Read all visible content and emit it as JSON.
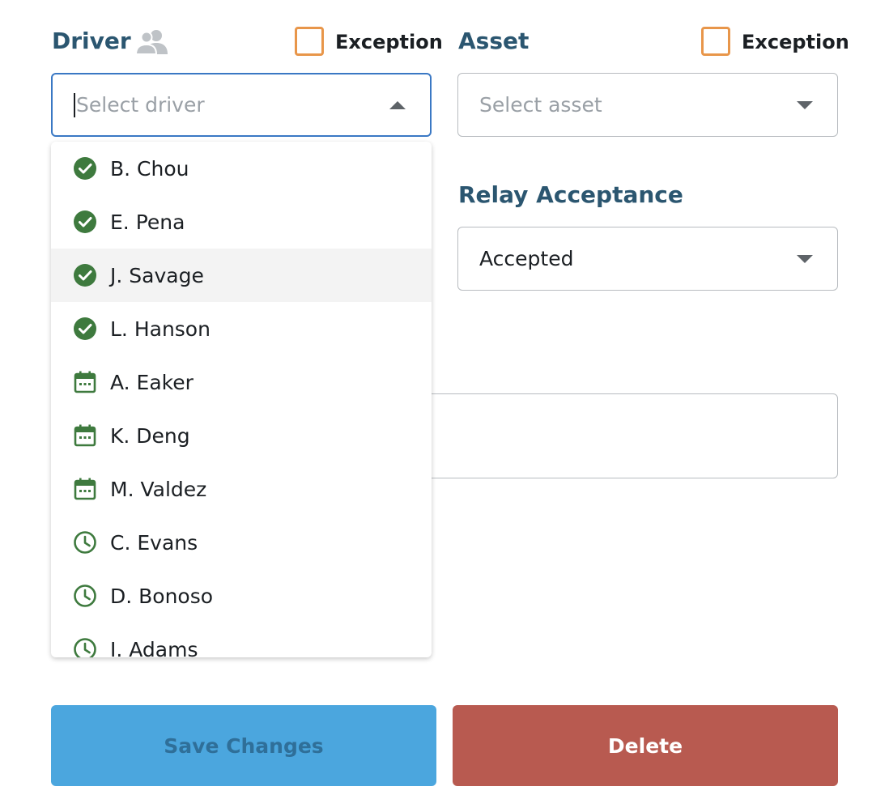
{
  "driver": {
    "label": "Driver",
    "exception_label": "Exception",
    "placeholder": "Select driver",
    "options": [
      {
        "name": "B. Chou",
        "status": "check"
      },
      {
        "name": "E. Pena",
        "status": "check"
      },
      {
        "name": "J. Savage",
        "status": "check"
      },
      {
        "name": "L. Hanson",
        "status": "check"
      },
      {
        "name": "A. Eaker",
        "status": "calendar"
      },
      {
        "name": "K. Deng",
        "status": "calendar"
      },
      {
        "name": "M. Valdez",
        "status": "calendar"
      },
      {
        "name": "C. Evans",
        "status": "clock"
      },
      {
        "name": "D. Bonoso",
        "status": "clock"
      },
      {
        "name": "I. Adams",
        "status": "clock"
      }
    ],
    "highlighted_index": 2
  },
  "asset": {
    "label": "Asset",
    "exception_label": "Exception",
    "placeholder": "Select asset"
  },
  "relay": {
    "label": "Relay Acceptance",
    "value": "Accepted"
  },
  "buttons": {
    "save": "Save Changes",
    "delete": "Delete"
  },
  "colors": {
    "label": "#2b5670",
    "exception_border": "#e8964a",
    "focus_border": "#3a78c4",
    "status_icon": "#3e7a3e",
    "save_bg": "#4ba6de",
    "delete_bg": "#b85a50"
  }
}
